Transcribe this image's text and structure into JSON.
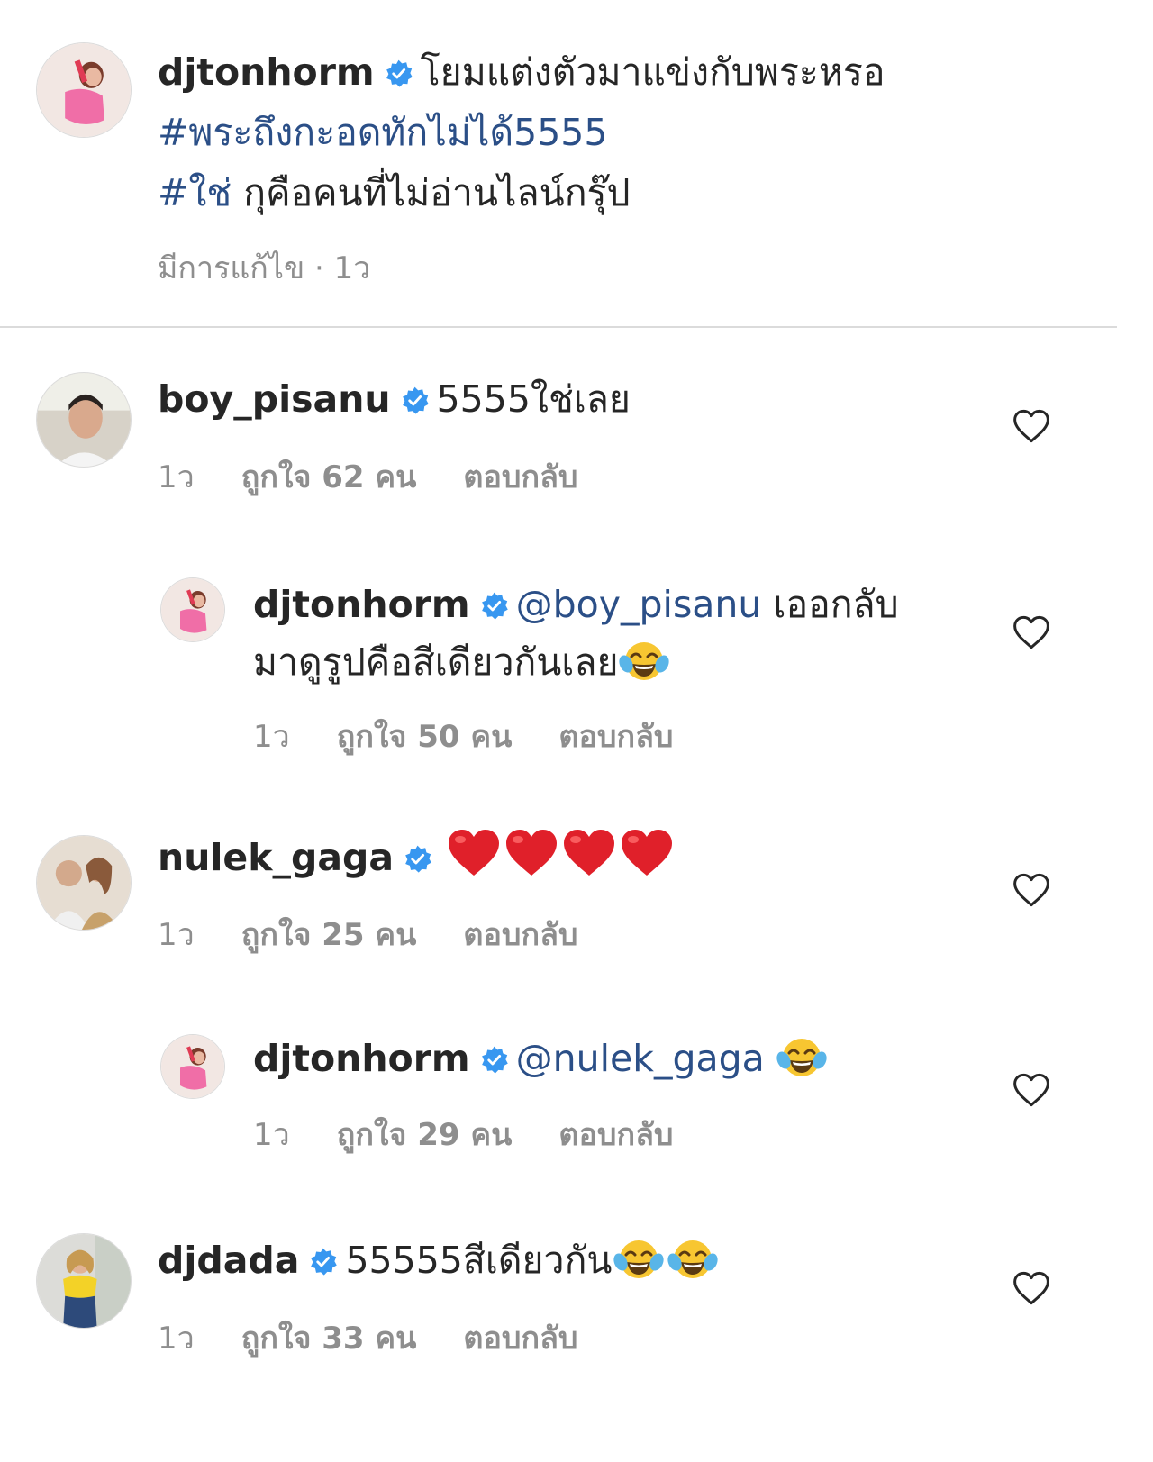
{
  "caption": {
    "username": "djtonhorm",
    "text": "โยมแต่งตัวมาแข่งกับพระหรอ",
    "hashtag_1": "#พระถึงกะอดทักไม่ได้5555",
    "hashtag_2": "#ใช่",
    "line_3_rest": "กุคือคนที่ไม่อ่านไลน์กรุ๊ป",
    "meta": "มีการแก้ไข · 1ว"
  },
  "comments": [
    {
      "username": "boy_pisanu",
      "text": "5555ใช่เลย",
      "time": "1ว",
      "likes": "ถูกใจ 62 คน",
      "reply": "ตอบกลับ"
    },
    {
      "username": "djtonhorm",
      "mention": "@boy_pisanu",
      "text": "เออกลับ",
      "text_2": "มาดูรูปคือสีเดียวกันเลย",
      "emoji_icon": "face-with-tears-of-joy-icon",
      "time": "1ว",
      "likes": "ถูกใจ 50 คน",
      "reply": "ตอบกลับ"
    },
    {
      "username": "nulek_gaga",
      "emoji_icon": "red-heart-icon",
      "emoji_count": 4,
      "time": "1ว",
      "likes": "ถูกใจ 25 คน",
      "reply": "ตอบกลับ"
    },
    {
      "username": "djtonhorm",
      "mention": "@nulek_gaga",
      "emoji_icon": "face-with-tears-of-joy-icon",
      "time": "1ว",
      "likes": "ถูกใจ 29 คน",
      "reply": "ตอบกลับ"
    },
    {
      "username": "djdada",
      "text": "55555สีเดียวกัน",
      "emoji_icon": "face-with-tears-of-joy-icon",
      "emoji_count": 2,
      "time": "1ว",
      "likes": "ถูกใจ 33 คน",
      "reply": "ตอบกลับ"
    }
  ],
  "colors": {
    "text": "#262626",
    "meta": "#8e8e8e",
    "link": "#2b4f87",
    "verified": "#3897f0",
    "divider": "#dbdbdb"
  }
}
